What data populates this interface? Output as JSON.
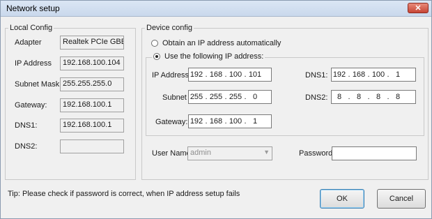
{
  "window": {
    "title": "Network setup",
    "close_label": "✕"
  },
  "local": {
    "legend": "Local Config",
    "rows": [
      {
        "label": "Adapter",
        "value": "Realtek PCIe GBE Fam"
      },
      {
        "label": "IP Address",
        "value": "192.168.100.104"
      },
      {
        "label": "Subnet Mask:",
        "value": "255.255.255.0"
      },
      {
        "label": "Gateway:",
        "value": "192.168.100.1"
      },
      {
        "label": "DNS1:",
        "value": "192.168.100.1"
      },
      {
        "label": "DNS2:",
        "value": ""
      }
    ]
  },
  "device": {
    "legend": "Device config",
    "radio_auto": "Obtain an IP address automatically",
    "radio_manual": "Use the following IP address:",
    "selected": "manual",
    "ip_label": "IP Address",
    "ip": [
      "192",
      "168",
      "100",
      "101"
    ],
    "subnet_label": "Subnet",
    "subnet": [
      "255",
      "255",
      "255",
      "0"
    ],
    "gateway_label": "Gateway:",
    "gateway": [
      "192",
      "168",
      "100",
      "1"
    ],
    "dns1_label": "DNS1:",
    "dns1": [
      "192",
      "168",
      "100",
      "1"
    ],
    "dns2_label": "DNS2:",
    "dns2": [
      "8",
      "8",
      "8",
      "8"
    ],
    "username_label": "User Name",
    "username_value": "admin",
    "password_label": "Password",
    "password_value": ""
  },
  "footer": {
    "tip": "Tip:  Please check if password is correct, when IP address setup fails",
    "ok": "OK",
    "cancel": "Cancel"
  }
}
